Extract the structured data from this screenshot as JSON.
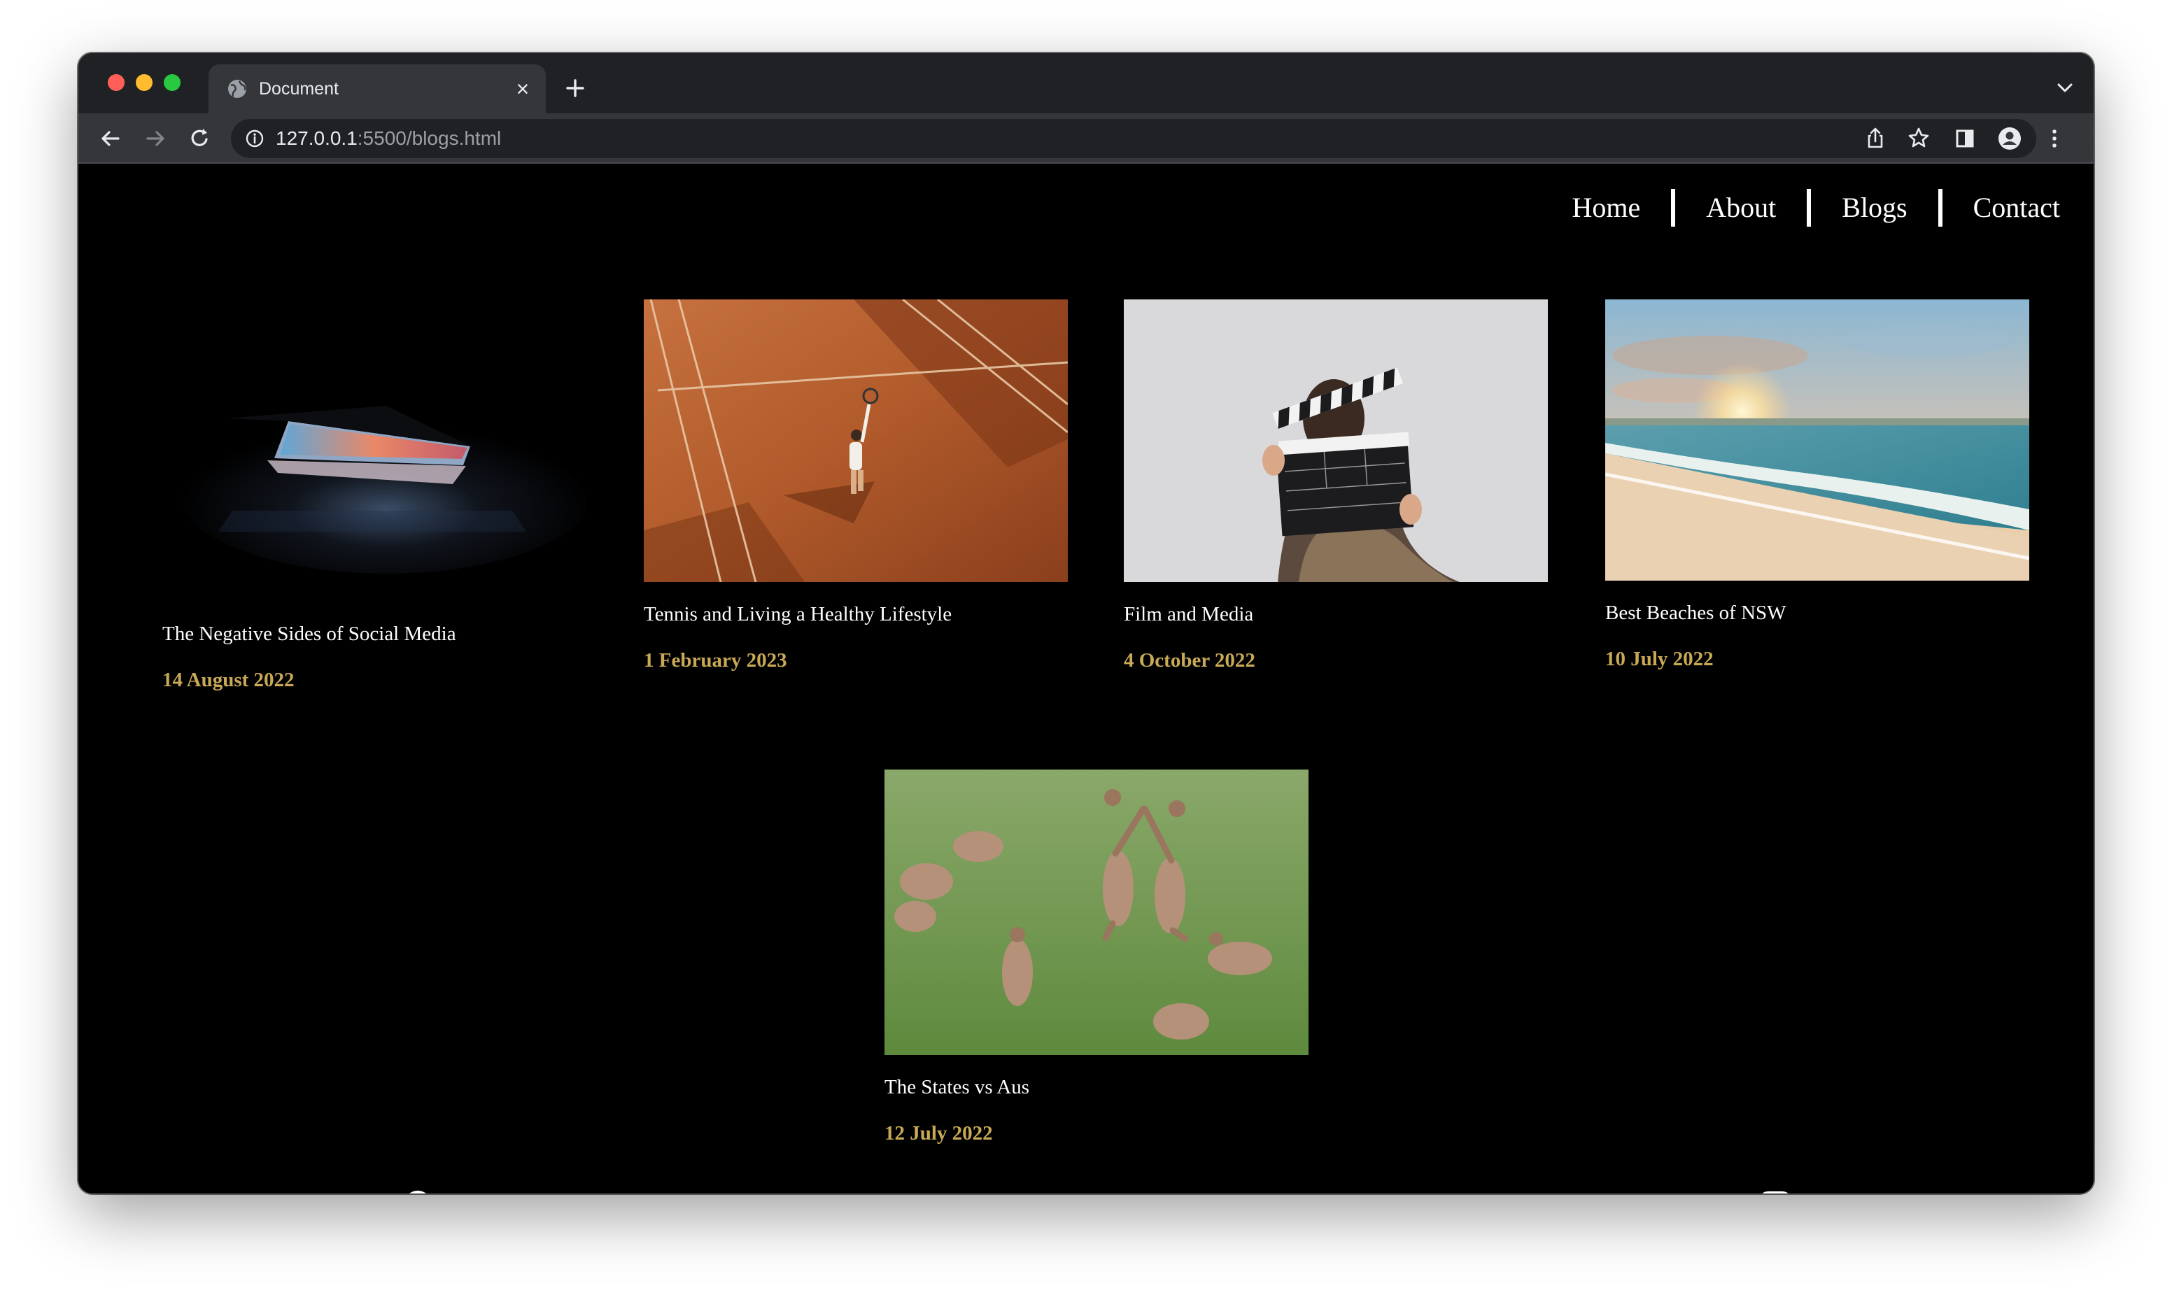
{
  "browser": {
    "tab_title": "Document",
    "url_host": "127.0.0.1",
    "url_rest": ":5500/blogs.html"
  },
  "nav": {
    "items": [
      "Home",
      "About",
      "Blogs",
      "Contact"
    ]
  },
  "posts": [
    {
      "title": "The Negative Sides of Social Media",
      "date": "14 August 2022",
      "image": "laptop-in-dark"
    },
    {
      "title": "Tennis and Living a Healthy Lifestyle",
      "date": "1 February 2023",
      "image": "tennis-player-on-clay-court"
    },
    {
      "title": "Film and Media",
      "date": "4 October 2022",
      "image": "person-holding-clapperboard"
    },
    {
      "title": "Best Beaches of NSW",
      "date": "10 July 2022",
      "image": "beach-at-sunset"
    },
    {
      "title": "The States vs Aus",
      "date": "12 July 2022",
      "image": "kangaroos-on-grass"
    }
  ],
  "colors": {
    "page_background": "#000000",
    "date_accent": "#c9a956",
    "browser_chrome": "#202124",
    "toolbar": "#35363a"
  }
}
